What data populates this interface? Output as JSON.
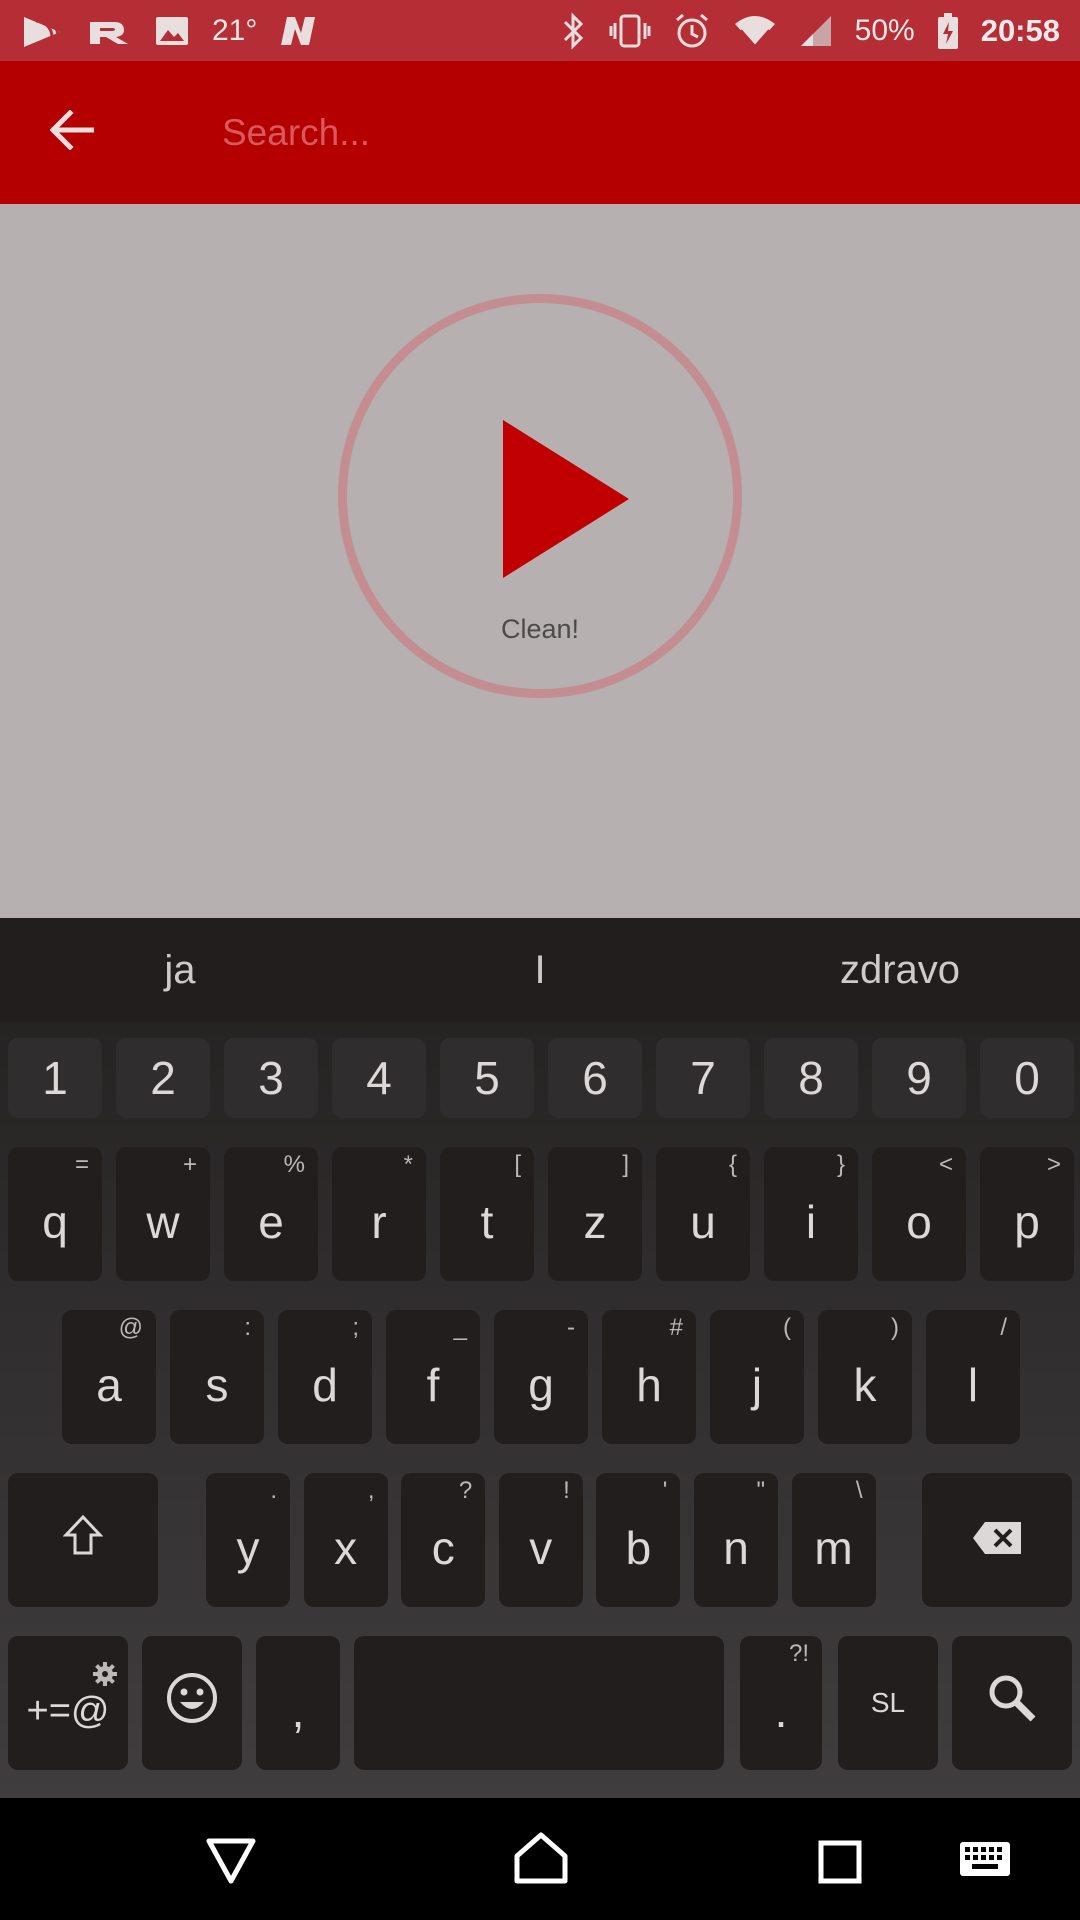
{
  "status_bar": {
    "temperature": "21°",
    "battery_percent": "50%",
    "time": "20:58",
    "left_icons": [
      "cast-icon",
      "r-app-icon",
      "image-icon",
      "temperature-text",
      "n-app-icon"
    ],
    "right_icons": [
      "bluetooth-icon",
      "vibrate-icon",
      "alarm-icon",
      "wifi-icon",
      "signal-icon",
      "battery-charging-icon"
    ]
  },
  "app_bar": {
    "back_icon": "arrow-left-icon",
    "search_placeholder": "Search..."
  },
  "main": {
    "play_icon": "play-icon",
    "clean_label": "Clean!"
  },
  "keyboard": {
    "suggestions": [
      "ja",
      "I",
      "zdravo"
    ],
    "number_row": [
      "1",
      "2",
      "3",
      "4",
      "5",
      "6",
      "7",
      "8",
      "9",
      "0"
    ],
    "row1": [
      {
        "key": "q",
        "sub": "="
      },
      {
        "key": "w",
        "sub": "+"
      },
      {
        "key": "e",
        "sub": "%"
      },
      {
        "key": "r",
        "sub": "*"
      },
      {
        "key": "t",
        "sub": "["
      },
      {
        "key": "z",
        "sub": "]"
      },
      {
        "key": "u",
        "sub": "{"
      },
      {
        "key": "i",
        "sub": "}"
      },
      {
        "key": "o",
        "sub": "<"
      },
      {
        "key": "p",
        "sub": ">"
      }
    ],
    "row2": [
      {
        "key": "a",
        "sub": "@"
      },
      {
        "key": "s",
        "sub": ":"
      },
      {
        "key": "d",
        "sub": ";"
      },
      {
        "key": "f",
        "sub": "_"
      },
      {
        "key": "g",
        "sub": "-"
      },
      {
        "key": "h",
        "sub": "#"
      },
      {
        "key": "j",
        "sub": "("
      },
      {
        "key": "k",
        "sub": ")"
      },
      {
        "key": "l",
        "sub": "/"
      }
    ],
    "row3": [
      {
        "key": "y",
        "sub": "."
      },
      {
        "key": "x",
        "sub": ","
      },
      {
        "key": "c",
        "sub": "?"
      },
      {
        "key": "v",
        "sub": "!"
      },
      {
        "key": "b",
        "sub": "'"
      },
      {
        "key": "n",
        "sub": "\""
      },
      {
        "key": "m",
        "sub": "\\"
      }
    ],
    "symbols_key": "+=@",
    "comma_key": ",",
    "period_key": ".",
    "period_sub": "?!",
    "language_key": "SL",
    "shift_icon": "shift-icon",
    "backspace_icon": "backspace-icon",
    "emoji_icon": "emoji-icon",
    "settings_icon": "gear-icon",
    "search_icon": "search-icon"
  },
  "nav_bar": {
    "icons": [
      "back-triangle-icon",
      "home-icon",
      "recents-icon",
      "keyboard-icon"
    ]
  },
  "colors": {
    "status_bar": "#b52e35",
    "app_bar": "#b40000",
    "content_bg": "#b6b0b0",
    "play_red": "#c00000",
    "circle_ring": "#c48d92",
    "key_bg": "#221e1e"
  }
}
